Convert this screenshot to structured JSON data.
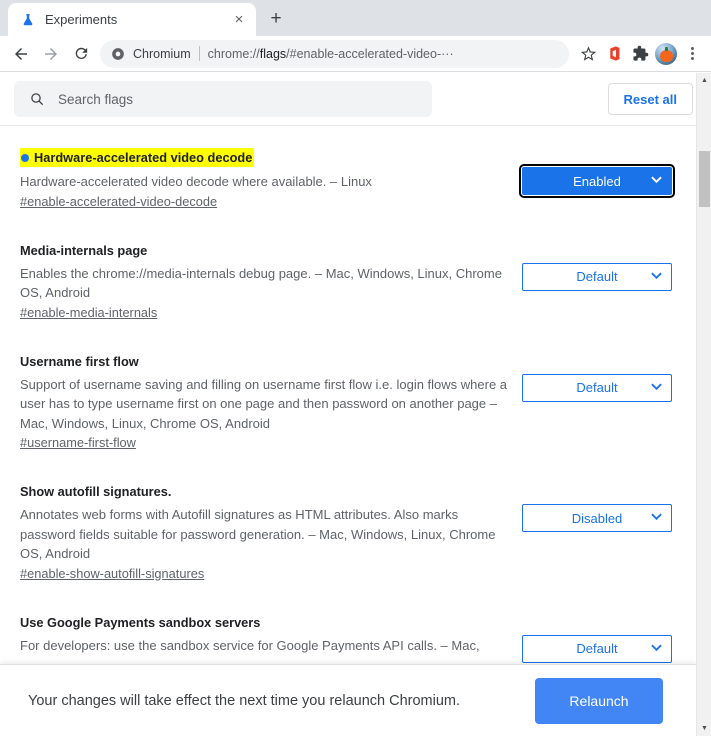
{
  "window": {
    "tab": {
      "title": "Experiments",
      "favicon": "beaker-icon",
      "close_label": "×"
    },
    "new_tab_label": "+",
    "toolbar": {
      "back_label": "←",
      "forward_label": "→",
      "reload_label": "⟳",
      "omnibox": {
        "security_icon": "chromium-shield-icon",
        "scheme_chip": "Chromium",
        "url_prefix": "chrome://",
        "url_bold": "flags",
        "url_suffix": "/#enable-accelerated-video-···"
      },
      "bookmark_label": "☆",
      "office_ext_label": "office-extension-icon",
      "extensions_label": "puzzle-icon",
      "avatar_label": "profile-avatar",
      "menu_label": "three-dot-menu"
    }
  },
  "flags_page": {
    "search": {
      "placeholder": "Search flags",
      "value": "",
      "icon": "search-icon"
    },
    "reset_all_label": "Reset all",
    "flags": [
      {
        "title": "Hardware-accelerated video decode",
        "highlighted": true,
        "bullet": true,
        "description": "Hardware-accelerated video decode where available. – Linux",
        "permalink": "#enable-accelerated-video-decode",
        "state": "Enabled",
        "state_style": "enabled"
      },
      {
        "title": "Media-internals page",
        "highlighted": false,
        "bullet": false,
        "description": "Enables the chrome://media-internals debug page. – Mac, Windows, Linux, Chrome OS, Android",
        "permalink": "#enable-media-internals",
        "state": "Default",
        "state_style": "default"
      },
      {
        "title": "Username first flow",
        "highlighted": false,
        "bullet": false,
        "description": "Support of username saving and filling on username first flow i.e. login flows where a user has to type username first on one page and then password on another page – Mac, Windows, Linux, Chrome OS, Android",
        "permalink": "#username-first-flow",
        "state": "Default",
        "state_style": "default"
      },
      {
        "title": "Show autofill signatures.",
        "highlighted": false,
        "bullet": false,
        "description": "Annotates web forms with Autofill signatures as HTML attributes. Also marks password fields suitable for password generation. – Mac, Windows, Linux, Chrome OS, Android",
        "permalink": "#enable-show-autofill-signatures",
        "state": "Disabled",
        "state_style": "default"
      },
      {
        "title": "Use Google Payments sandbox servers",
        "highlighted": false,
        "bullet": false,
        "description": "For developers: use the sandbox service for Google Payments API calls. – Mac,",
        "permalink": "",
        "state": "Default",
        "state_style": "default"
      }
    ],
    "relaunch": {
      "message": "Your changes will take effect the next time you relaunch Chromium.",
      "button_label": "Relaunch"
    },
    "select_chevron": "⌄",
    "scrollbar": {
      "up_arrow": "▲",
      "down_arrow": "▼"
    }
  },
  "colors": {
    "accent_blue": "#1a73e8",
    "relaunch_blue": "#4285f4",
    "highlight_yellow": "#ffff00",
    "tabstrip_grey": "#dee1e6"
  }
}
